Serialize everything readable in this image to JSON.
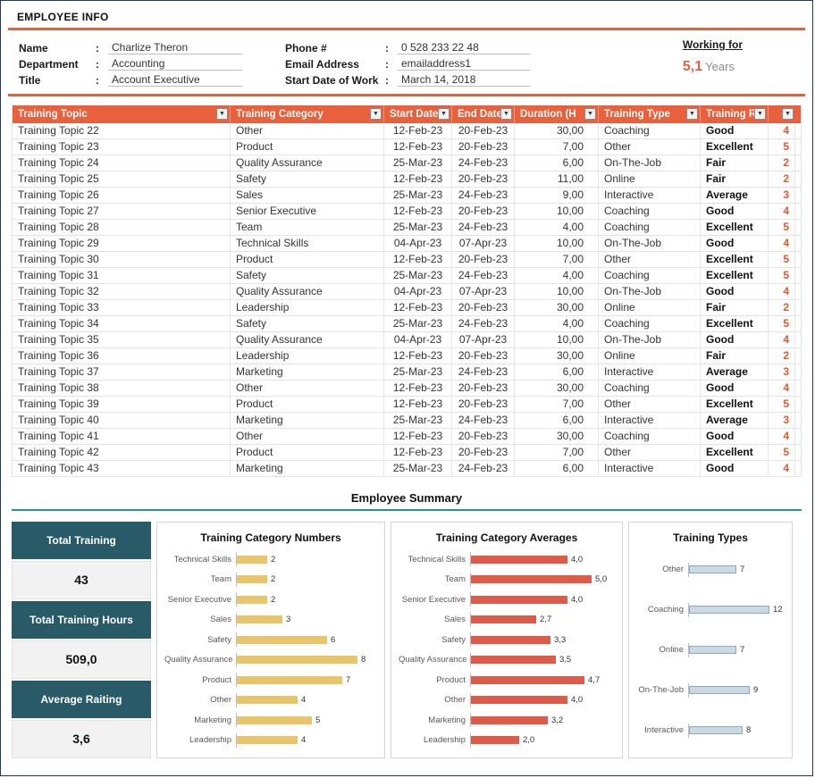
{
  "colors": {
    "accent_orange": "#E8613C",
    "rating_orange": "#E05A2B",
    "teal_rule": "#2E8F9E",
    "card_dark": "#295A68",
    "sheet_border": "#1F3864"
  },
  "employee_info": {
    "section_title": "EMPLOYEE INFO",
    "fields_left": [
      {
        "label": "Name",
        "value": "Charlize Theron"
      },
      {
        "label": "Department",
        "value": "Accounting"
      },
      {
        "label": "Title",
        "value": "Account Executive"
      }
    ],
    "fields_mid": [
      {
        "label": "Phone #",
        "value": "0 528 233 22 48"
      },
      {
        "label": "Email Address",
        "value": "emailaddress1"
      },
      {
        "label": "Start Date of Work",
        "value": "March 14, 2018"
      }
    ],
    "working_for": {
      "label": "Working for",
      "value": "5,1",
      "unit": "Years"
    }
  },
  "table": {
    "columns": [
      "Training Topic",
      "Training Category",
      "Start Date",
      "End Date",
      "Duration (H",
      "Training Type",
      "Training Rating",
      ""
    ],
    "rows": [
      [
        "Training Topic 22",
        "Other",
        "12-Feb-23",
        "20-Feb-23",
        "30,00",
        "Coaching",
        "Good",
        "4"
      ],
      [
        "Training Topic 23",
        "Product",
        "12-Feb-23",
        "20-Feb-23",
        "7,00",
        "Other",
        "Excellent",
        "5"
      ],
      [
        "Training Topic 24",
        "Quality Assurance",
        "25-Mar-23",
        "24-Feb-23",
        "6,00",
        "On-The-Job",
        "Fair",
        "2"
      ],
      [
        "Training Topic 25",
        "Safety",
        "12-Feb-23",
        "20-Feb-23",
        "11,00",
        "Online",
        "Fair",
        "2"
      ],
      [
        "Training Topic 26",
        "Sales",
        "25-Mar-23",
        "24-Feb-23",
        "9,00",
        "Interactive",
        "Average",
        "3"
      ],
      [
        "Training Topic 27",
        "Senior Executive",
        "12-Feb-23",
        "20-Feb-23",
        "10,00",
        "Coaching",
        "Good",
        "4"
      ],
      [
        "Training Topic 28",
        "Team",
        "25-Mar-23",
        "24-Feb-23",
        "4,00",
        "Coaching",
        "Excellent",
        "5"
      ],
      [
        "Training Topic 29",
        "Technical Skills",
        "04-Apr-23",
        "07-Apr-23",
        "10,00",
        "On-The-Job",
        "Good",
        "4"
      ],
      [
        "Training Topic 30",
        "Product",
        "12-Feb-23",
        "20-Feb-23",
        "7,00",
        "Other",
        "Excellent",
        "5"
      ],
      [
        "Training Topic 31",
        "Safety",
        "25-Mar-23",
        "24-Feb-23",
        "4,00",
        "Coaching",
        "Excellent",
        "5"
      ],
      [
        "Training Topic 32",
        "Quality Assurance",
        "04-Apr-23",
        "07-Apr-23",
        "10,00",
        "On-The-Job",
        "Good",
        "4"
      ],
      [
        "Training Topic 33",
        "Leadership",
        "12-Feb-23",
        "20-Feb-23",
        "30,00",
        "Online",
        "Fair",
        "2"
      ],
      [
        "Training Topic 34",
        "Safety",
        "25-Mar-23",
        "24-Feb-23",
        "4,00",
        "Coaching",
        "Excellent",
        "5"
      ],
      [
        "Training Topic 35",
        "Quality Assurance",
        "04-Apr-23",
        "07-Apr-23",
        "10,00",
        "On-The-Job",
        "Good",
        "4"
      ],
      [
        "Training Topic 36",
        "Leadership",
        "12-Feb-23",
        "20-Feb-23",
        "30,00",
        "Online",
        "Fair",
        "2"
      ],
      [
        "Training Topic 37",
        "Marketing",
        "25-Mar-23",
        "24-Feb-23",
        "6,00",
        "Interactive",
        "Average",
        "3"
      ],
      [
        "Training Topic 38",
        "Other",
        "12-Feb-23",
        "20-Feb-23",
        "30,00",
        "Coaching",
        "Good",
        "4"
      ],
      [
        "Training Topic 39",
        "Product",
        "12-Feb-23",
        "20-Feb-23",
        "7,00",
        "Other",
        "Excellent",
        "5"
      ],
      [
        "Training Topic 40",
        "Marketing",
        "25-Mar-23",
        "24-Feb-23",
        "6,00",
        "Interactive",
        "Average",
        "3"
      ],
      [
        "Training Topic 41",
        "Other",
        "12-Feb-23",
        "20-Feb-23",
        "30,00",
        "Coaching",
        "Good",
        "4"
      ],
      [
        "Training Topic 42",
        "Product",
        "12-Feb-23",
        "20-Feb-23",
        "7,00",
        "Other",
        "Excellent",
        "5"
      ],
      [
        "Training Topic 43",
        "Marketing",
        "25-Mar-23",
        "24-Feb-23",
        "6,00",
        "Interactive",
        "Good",
        "4"
      ]
    ]
  },
  "summary": {
    "title": "Employee Summary",
    "cards": [
      {
        "label": "Total Training",
        "value": "43"
      },
      {
        "label": "Total Training Hours",
        "value": "509,0"
      },
      {
        "label": "Average Raiting",
        "value": "3,6"
      }
    ]
  },
  "chart_data": [
    {
      "type": "bar",
      "orientation": "horizontal",
      "title": "Training Category Numbers",
      "categories": [
        "Technical Skills",
        "Team",
        "Senior Executive",
        "Sales",
        "Safety",
        "Quality Assurance",
        "Product",
        "Other",
        "Marketing",
        "Leadership"
      ],
      "values": [
        2,
        2,
        2,
        3,
        6,
        8,
        7,
        4,
        5,
        4
      ],
      "labels": [
        "2",
        "2",
        "2",
        "3",
        "6",
        "8",
        "7",
        "4",
        "5",
        "4"
      ],
      "xlim": [
        0,
        8
      ],
      "max": 8,
      "color": "#E8C46A",
      "grid": false,
      "legend": "none"
    },
    {
      "type": "bar",
      "orientation": "horizontal",
      "title": "Training Category Averages",
      "categories": [
        "Technical Skills",
        "Team",
        "Senior Executive",
        "Sales",
        "Safety",
        "Quality Assurance",
        "Product",
        "Other",
        "Marketing",
        "Leadership"
      ],
      "values": [
        4.0,
        5.0,
        4.0,
        2.7,
        3.3,
        3.5,
        4.7,
        4.0,
        3.2,
        2.0
      ],
      "labels": [
        "4,0",
        "5,0",
        "4,0",
        "2,7",
        "3,3",
        "3,5",
        "4,7",
        "4,0",
        "3,2",
        "2,0"
      ],
      "xlim": [
        0,
        5
      ],
      "max": 5,
      "color": "#DF5B49",
      "grid": false,
      "legend": "none"
    },
    {
      "type": "bar",
      "orientation": "horizontal",
      "title": "Training Types",
      "categories": [
        "Other",
        "Coaching",
        "Online",
        "On-The-Job",
        "Interactive"
      ],
      "values": [
        7,
        12,
        7,
        9,
        8
      ],
      "labels": [
        "7",
        "12",
        "7",
        "9",
        "8"
      ],
      "xlim": [
        0,
        12
      ],
      "max": 12,
      "color": "#CBD9E4",
      "border": "#8FA8BA",
      "grid": false,
      "legend": "none"
    }
  ]
}
